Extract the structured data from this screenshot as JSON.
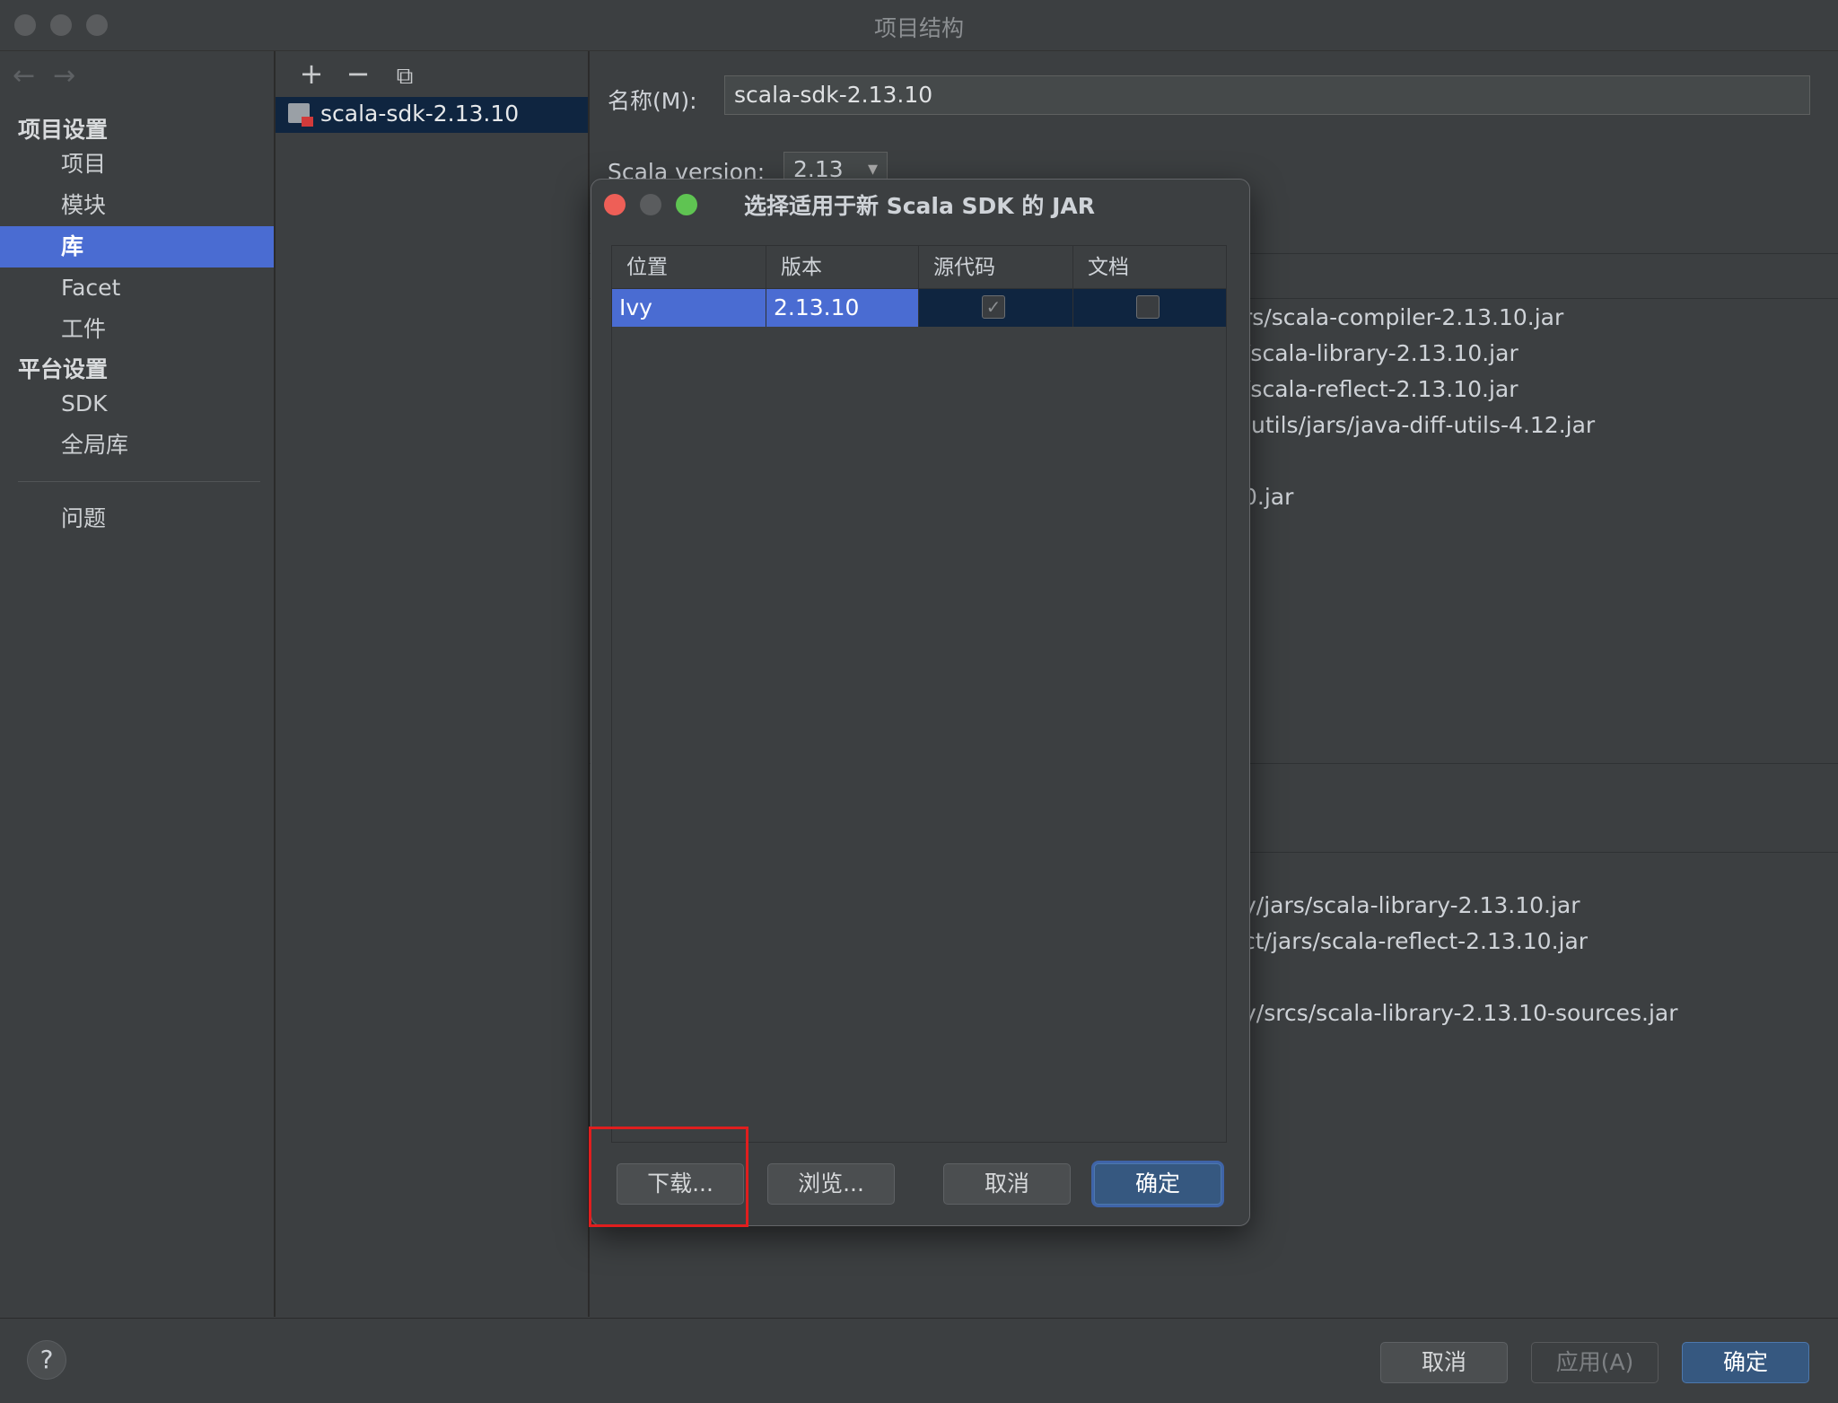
{
  "window": {
    "title": "项目结构"
  },
  "nav": {
    "section_project": "项目设置",
    "items_project": [
      {
        "label": "项目"
      },
      {
        "label": "模块"
      },
      {
        "label": "库"
      },
      {
        "label": "Facet"
      },
      {
        "label": "工件"
      }
    ],
    "section_platform": "平台设置",
    "items_platform": [
      {
        "label": "SDK"
      },
      {
        "label": "全局库"
      }
    ],
    "problems": "问题"
  },
  "libraries": {
    "toolbar": {
      "add": "+",
      "remove": "−",
      "copy": "⧉"
    },
    "selected": "scala-sdk-2.13.10"
  },
  "library_detail": {
    "name_label": "名称(M):",
    "name_value": "scala-sdk-2.13.10",
    "scala_version_label": "Scala version:",
    "scala_version_value": "2.13",
    "compiler_paths": [
      "rs/scala-compiler-2.13.10.jar",
      "/scala-library-2.13.10.jar",
      "/scala-reflect-2.13.10.jar",
      "-utils/jars/java-diff-utils-4.12.jar",
      "0.jar"
    ],
    "classes_paths": [
      "y/jars/scala-library-2.13.10.jar",
      "ct/jars/scala-reflect-2.13.10.jar"
    ],
    "sources_paths": [
      "y/srcs/scala-library-2.13.10-sources.jar"
    ]
  },
  "dialog": {
    "title": "选择适用于新 Scala SDK 的 JAR",
    "columns": [
      "位置",
      "版本",
      "源代码",
      "文档"
    ],
    "rows": [
      {
        "location": "Ivy",
        "version": "2.13.10",
        "sources": true,
        "docs": false
      }
    ],
    "buttons": {
      "download": "下载...",
      "browse": "浏览...",
      "cancel": "取消",
      "ok": "确定"
    }
  },
  "footer": {
    "help": "?",
    "cancel": "取消",
    "apply": "应用(A)",
    "ok": "确定"
  }
}
